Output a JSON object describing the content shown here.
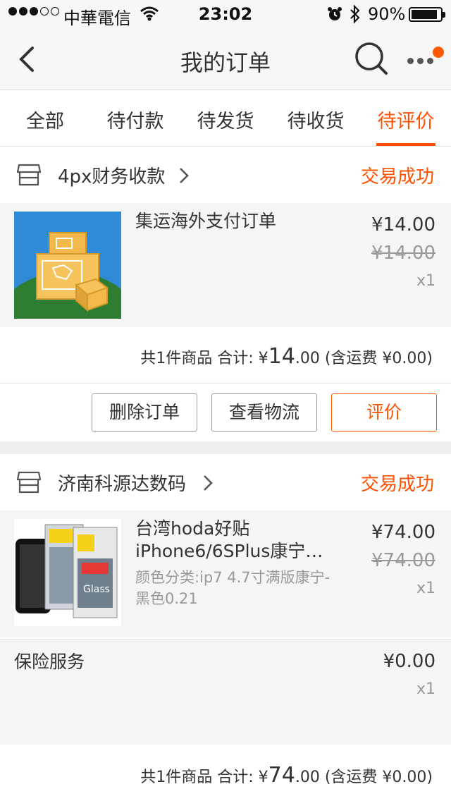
{
  "status_bar": {
    "carrier": "中華電信",
    "time": "23:02",
    "battery": "90%",
    "battery_level": 0.9,
    "icons": [
      "signal-dots-icon",
      "wifi-icon",
      "alarm-icon",
      "bluetooth-icon",
      "battery-icon"
    ]
  },
  "nav": {
    "title": "我的订单",
    "back_icon": "chevron-left-icon",
    "search_icon": "search-icon",
    "more_icon": "more-dots-icon",
    "badge_color": "#ff5a00"
  },
  "tabs": [
    {
      "label": "全部",
      "active": false
    },
    {
      "label": "待付款",
      "active": false
    },
    {
      "label": "待发货",
      "active": false
    },
    {
      "label": "待收货",
      "active": false
    },
    {
      "label": "待评价",
      "active": true
    }
  ],
  "accent_color": "#ff5000",
  "orders": [
    {
      "shop": "4px财务收款",
      "status": "交易成功",
      "items": [
        {
          "title": "集运海外支付订单",
          "sku": "",
          "price": "¥14.00",
          "original_price": "¥14.00",
          "quantity": "x1"
        }
      ],
      "summary": {
        "count_text": "共1件商品 合计:",
        "currency": "¥",
        "int": "14",
        "dec": ".00",
        "shipping": "(含运费 ¥0.00)"
      },
      "actions": [
        "删除订单",
        "查看物流",
        "评价"
      ]
    },
    {
      "shop": "济南科源达数码",
      "status": "交易成功",
      "items": [
        {
          "title": "台湾hoda好贴iPhone6/6SPlus康宁…",
          "sku": "颜色分类:ip7 4.7寸满版康宁-黑色0.21",
          "price": "¥74.00",
          "original_price": "¥74.00",
          "quantity": "x1"
        }
      ],
      "service": {
        "label": "保险服务",
        "price": "¥0.00",
        "quantity": "x1"
      },
      "summary": {
        "count_text": "共1件商品 合计:",
        "currency": "¥",
        "int": "74",
        "dec": ".00",
        "shipping": "(含运费 ¥0.00)"
      }
    }
  ]
}
